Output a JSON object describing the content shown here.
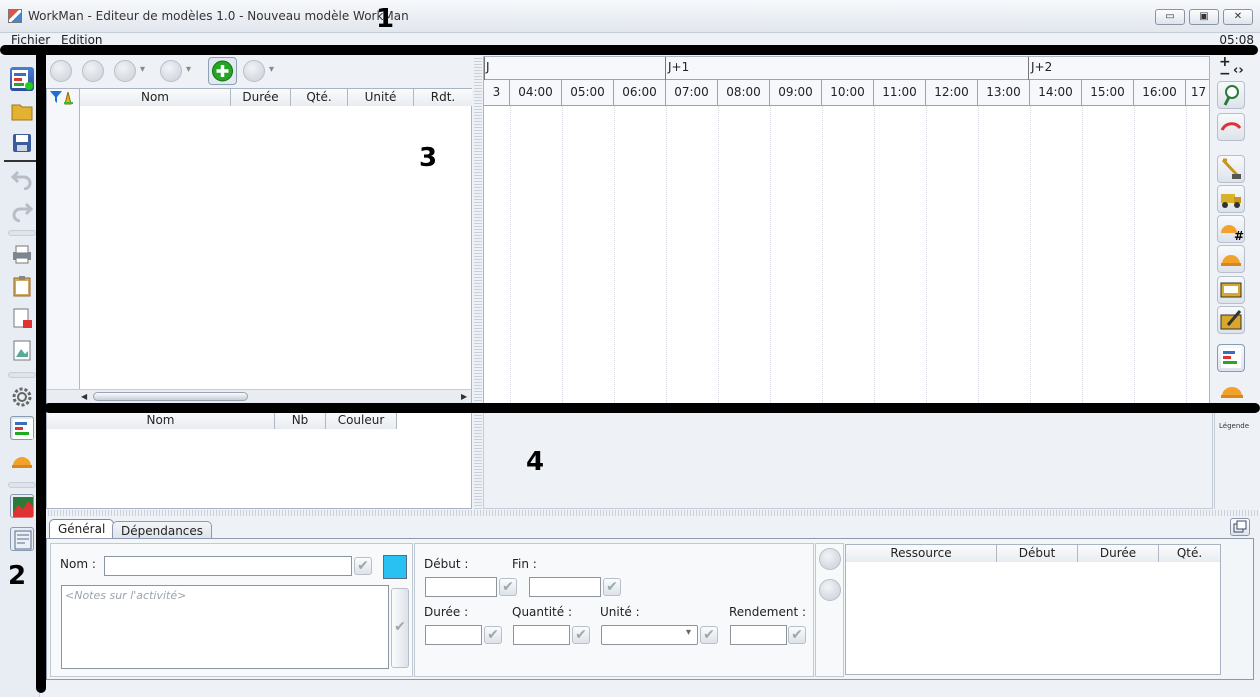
{
  "window": {
    "title": "WorkMan - Editeur de modèles 1.0  - Nouveau modèle WorkMan",
    "minimize_glyph": "▭",
    "maximize_glyph": "▣",
    "close_glyph": "✕"
  },
  "menu": {
    "items": [
      "Fichier",
      "Edition"
    ],
    "clock": "05:08"
  },
  "callouts": [
    "1",
    "2",
    "3",
    "4"
  ],
  "activity_table": {
    "columns": [
      "Nom",
      "Durée",
      "Qté.",
      "Unité",
      "Rdt."
    ]
  },
  "timeline": {
    "days": [
      "J",
      "J+1",
      "J+2"
    ],
    "hours": [
      "3",
      "04:00",
      "05:00",
      "06:00",
      "07:00",
      "08:00",
      "09:00",
      "10:00",
      "11:00",
      "12:00",
      "13:00",
      "14:00",
      "15:00",
      "16:00",
      "17"
    ]
  },
  "zoom_controls": {
    "plus": "+",
    "minus": "−",
    "arrows": "‹›"
  },
  "legend_table": {
    "columns": [
      "Nom",
      "Nb",
      "Couleur"
    ],
    "label": "Légende"
  },
  "tabs": [
    "Général",
    "Dépendances"
  ],
  "general": {
    "name_label": "Nom :",
    "notes_placeholder": "<Notes sur l'activité>",
    "swatch_color": "#29c0f2"
  },
  "timing": {
    "debut": "Début :",
    "fin": "Fin :",
    "duree": "Durée :",
    "quantite": "Quantité :",
    "unite": "Unité :",
    "rendement": "Rendement :"
  },
  "resources_table": {
    "columns": [
      "Ressource",
      "Début",
      "Durée",
      "Qté."
    ]
  },
  "check_glyph": "✔",
  "dropdown_glyph": "▾"
}
